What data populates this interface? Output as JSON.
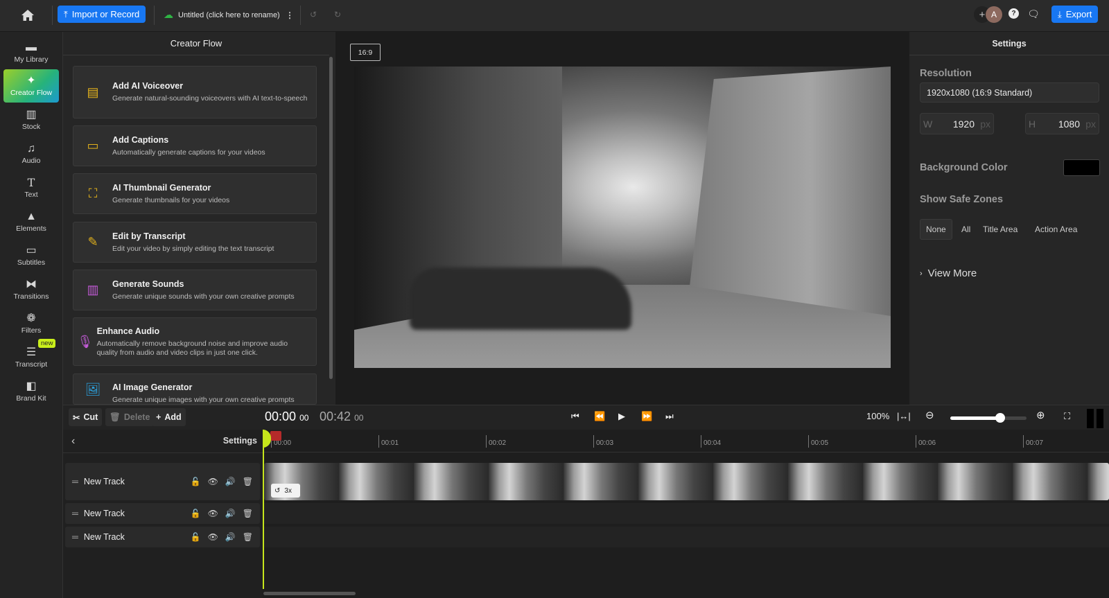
{
  "topbar": {
    "import_label": "Import or Record",
    "project_title": "Untitled (click here to rename)",
    "avatar_initial": "A",
    "export_label": "Export",
    "accent": "#1877f2"
  },
  "sidebar": {
    "items": [
      {
        "label": "My Library"
      },
      {
        "label": "Creator Flow"
      },
      {
        "label": "Stock"
      },
      {
        "label": "Audio"
      },
      {
        "label": "Text"
      },
      {
        "label": "Elements"
      },
      {
        "label": "Subtitles"
      },
      {
        "label": "Transitions"
      },
      {
        "label": "Filters"
      },
      {
        "label": "Transcript"
      },
      {
        "label": "Brand Kit"
      }
    ],
    "new_badge": "new"
  },
  "flow": {
    "title": "Creator Flow",
    "cards": [
      {
        "title": "Add AI Voiceover",
        "desc": "Generate natural-sounding voiceovers with AI text-to-speech"
      },
      {
        "title": "Add Captions",
        "desc": "Automatically generate captions for your videos"
      },
      {
        "title": "AI Thumbnail Generator",
        "desc": "Generate thumbnails for your videos"
      },
      {
        "title": "Edit by Transcript",
        "desc": "Edit your video by simply editing the text transcript"
      },
      {
        "title": "Generate Sounds",
        "desc": "Generate unique sounds with your own creative prompts"
      },
      {
        "title": "Enhance Audio",
        "desc": "Automatically remove background noise and improve audio quality from audio and video clips in just one click."
      },
      {
        "title": "AI Image Generator",
        "desc": "Generate unique images with your own creative prompts"
      }
    ]
  },
  "preview": {
    "aspect_ratio": "16:9"
  },
  "settings": {
    "title": "Settings",
    "resolution_label": "Resolution",
    "resolution_value": "1920x1080 (16:9 Standard)",
    "width_label": "W",
    "width_value": "1920",
    "height_label": "H",
    "height_value": "1080",
    "unit": "px",
    "bg_label": "Background Color",
    "bg_color": "#000000",
    "safe_label": "Show Safe Zones",
    "safe_options": [
      "None",
      "All",
      "Title Area",
      "Action Area"
    ],
    "view_more": "View More"
  },
  "toolbar": {
    "cut": "Cut",
    "delete": "Delete",
    "add": "Add",
    "current_time": "00:00",
    "current_frames": "00",
    "total_time": "00:42",
    "total_frames": "00",
    "zoom": "100%",
    "zoom_slider_fraction": 0.65
  },
  "timeline": {
    "settings_label": "Settings",
    "ticks": [
      "00:00",
      "00:01",
      "00:02",
      "00:03",
      "00:04",
      "00:05",
      "00:06",
      "00:07"
    ],
    "tracks": [
      {
        "name": "New Track"
      },
      {
        "name": "New Track"
      },
      {
        "name": "New Track"
      }
    ],
    "clip_speed": "3x"
  }
}
